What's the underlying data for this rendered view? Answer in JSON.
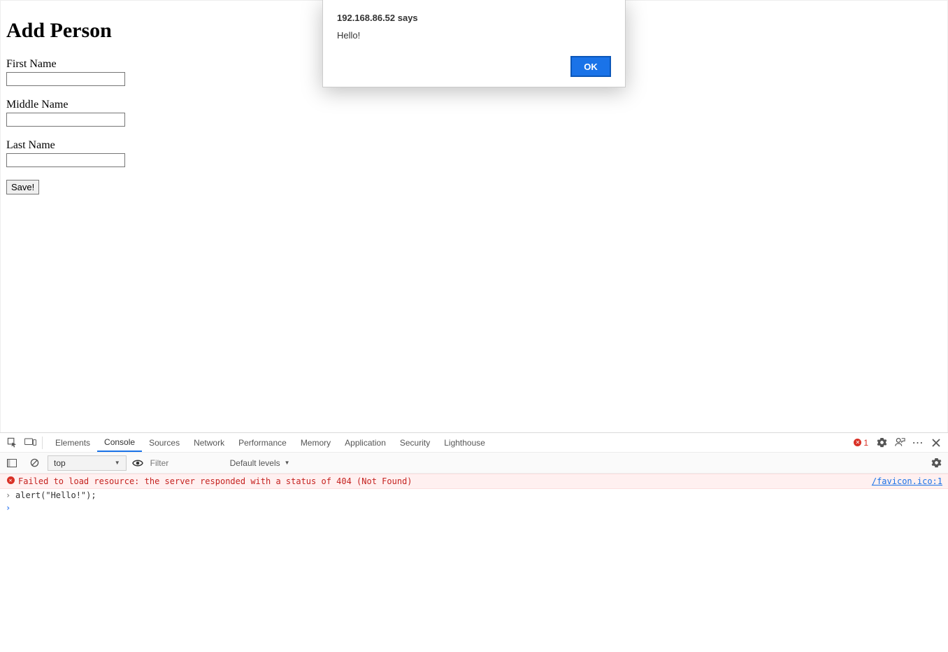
{
  "page": {
    "heading": "Add Person",
    "fields": {
      "first": {
        "label": "First Name",
        "value": ""
      },
      "middle": {
        "label": "Middle Name",
        "value": ""
      },
      "last": {
        "label": "Last Name",
        "value": ""
      }
    },
    "save_label": "Save!"
  },
  "alert": {
    "title": "192.168.86.52 says",
    "message": "Hello!",
    "ok_label": "OK"
  },
  "devtools": {
    "tabs": {
      "elements": "Elements",
      "console": "Console",
      "sources": "Sources",
      "network": "Network",
      "performance": "Performance",
      "memory": "Memory",
      "application": "Application",
      "security": "Security",
      "lighthouse": "Lighthouse"
    },
    "active_tab": "console",
    "error_count": "1",
    "console_toolbar": {
      "context": "top",
      "filter_placeholder": "Filter",
      "levels_label": "Default levels"
    },
    "log": {
      "error_text": "Failed to load resource: the server responded with a status of 404 (Not Found)",
      "error_source": "/favicon.ico:1",
      "prev_input": "alert(\"Hello!\");"
    }
  }
}
